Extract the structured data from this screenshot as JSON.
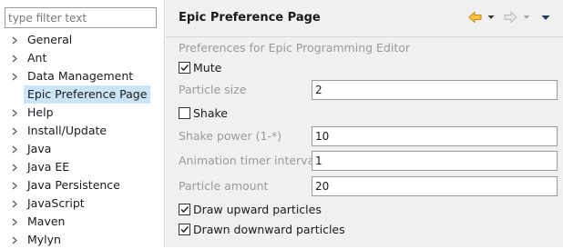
{
  "sidebar": {
    "filter_placeholder": "type filter text",
    "items": [
      {
        "label": "General",
        "expandable": true
      },
      {
        "label": "Ant",
        "expandable": true
      },
      {
        "label": "Data Management",
        "expandable": true
      },
      {
        "label": "Epic Preference Page",
        "expandable": false,
        "selected": true
      },
      {
        "label": "Help",
        "expandable": true
      },
      {
        "label": "Install/Update",
        "expandable": true
      },
      {
        "label": "Java",
        "expandable": true
      },
      {
        "label": "Java EE",
        "expandable": true
      },
      {
        "label": "Java Persistence",
        "expandable": true
      },
      {
        "label": "JavaScript",
        "expandable": true
      },
      {
        "label": "Maven",
        "expandable": true
      },
      {
        "label": "Mylyn",
        "expandable": true
      }
    ]
  },
  "page": {
    "title": "Epic Preference Page",
    "description": "Preferences for Epic Programming Editor",
    "mute": {
      "label": "Mute",
      "checked": true
    },
    "particle_size": {
      "label": "Particle size",
      "value": "2"
    },
    "shake": {
      "label": "Shake",
      "checked": false
    },
    "shake_power": {
      "label": "Shake power (1-*)",
      "value": "10"
    },
    "animation_timer": {
      "label": "Animation timer interval",
      "value": "1"
    },
    "particle_amount": {
      "label": "Particle amount",
      "value": "20"
    },
    "draw_upward": {
      "label": "Draw upward particles",
      "checked": true
    },
    "drawn_downward": {
      "label": "Drawn downward particles",
      "checked": true
    }
  },
  "header_icons": [
    "back-arrow-icon",
    "back-dropdown-icon",
    "forward-arrow-icon",
    "forward-dropdown-icon",
    "view-menu-icon"
  ],
  "colors": {
    "selection": "#cce4f7",
    "back_arrow": "#e8a317",
    "forward_arrow_disabled": "#b8b8b8"
  }
}
